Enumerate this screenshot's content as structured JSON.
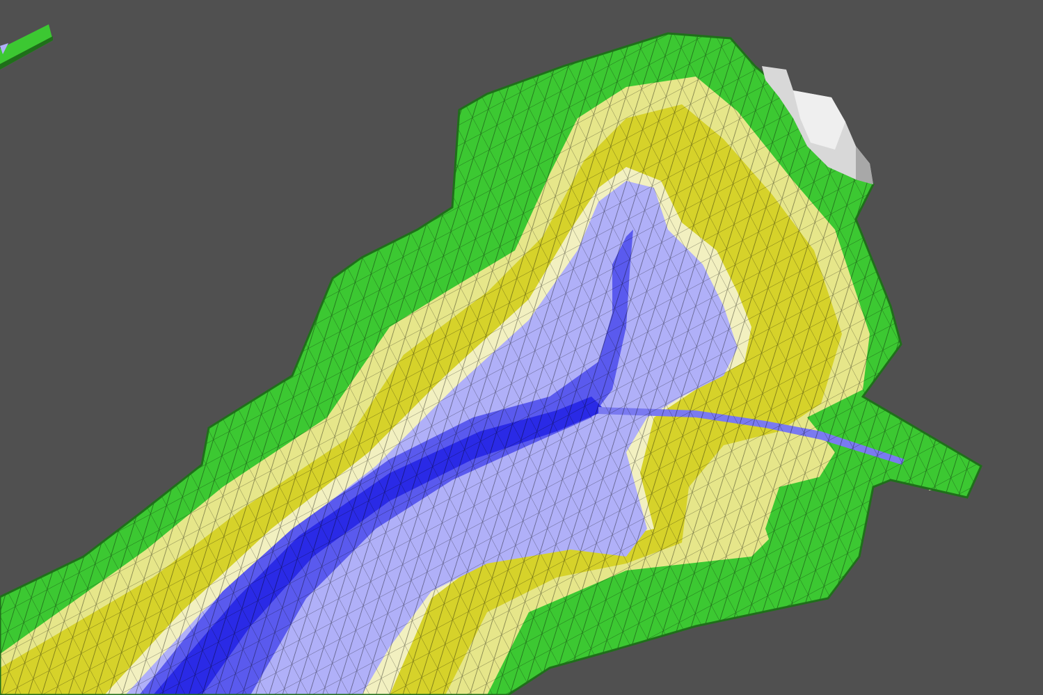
{
  "view": {
    "type": "3d-terrain-mesh",
    "background_color": "#505050",
    "mesh_line_color": "#000000",
    "shading": "elevation-color-ramp",
    "color_ramp": {
      "deep_channel": "#2a2ae6",
      "channel": "#5a5aee",
      "shallow_water": "#b0b0f8",
      "tidal_flat": "#f2f0c0",
      "mid_flat": "#d6d22a",
      "high_flat": "#e6e68a",
      "marsh": "#3cc832",
      "upland_edge": "#2c9a22",
      "rock_outcrop": "#d8d8d8"
    },
    "features": [
      "estuary-basin",
      "tidal-channel",
      "tributary-channel",
      "inlet-pipe",
      "rock-outcrop",
      "marsh-fringe",
      "offscreen-mesh-fragment"
    ]
  }
}
